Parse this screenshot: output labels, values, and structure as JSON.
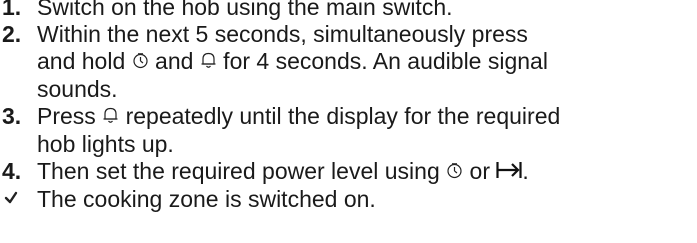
{
  "instructions": {
    "step1": {
      "number": "1.",
      "text": "Switch on the hob using the main switch."
    },
    "step2": {
      "number": "2.",
      "line1": "Within the next 5 seconds, simultaneously press",
      "line2_a": "and hold ",
      "line2_b": " and ",
      "line2_c": " for 4 seconds. An audible signal",
      "line3": "sounds."
    },
    "step3": {
      "number": "3.",
      "line1_a": "Press ",
      "line1_b": " repeatedly until the display for the required",
      "line2": "hob lights up."
    },
    "step4": {
      "number": "4.",
      "text_a": "Then set the required power level using ",
      "text_b": " or ",
      "text_c": "."
    },
    "result": {
      "text": "The cooking zone is switched on."
    }
  },
  "icons": {
    "timer": "timer-icon",
    "bell": "bell-icon",
    "boost": "boost-arrow-icon",
    "check": "check-icon"
  }
}
